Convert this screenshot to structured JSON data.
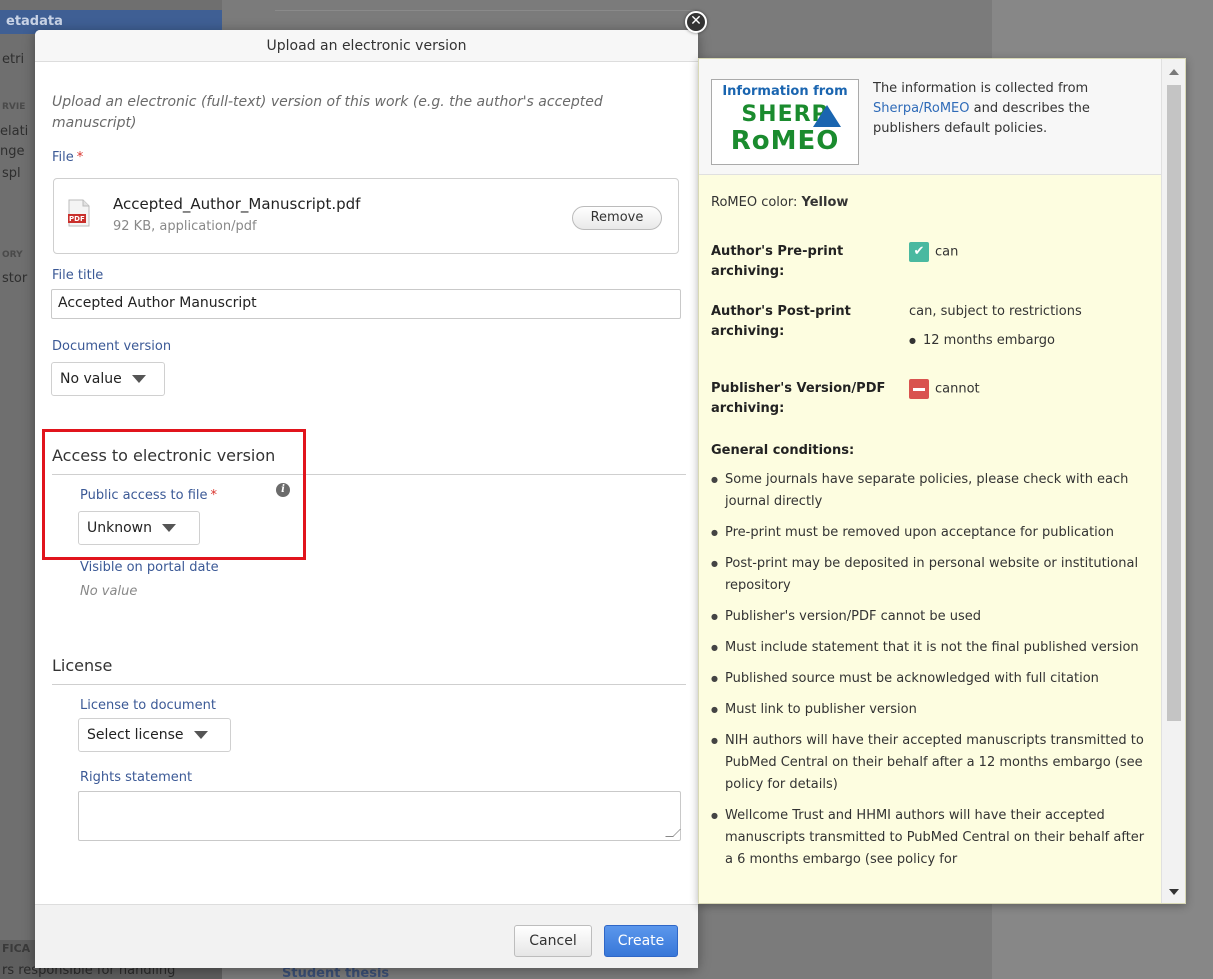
{
  "background": {
    "tab_label": "etadata",
    "side_items": [
      "etri",
      "RVIE",
      "elati",
      "nge",
      "spl",
      "ORY",
      "stor"
    ],
    "footer_caption": "FICA",
    "footer_text": "rs responsible for handling",
    "student_link": "Student thesis"
  },
  "dialog": {
    "title": "Upload an electronic version",
    "intro": "Upload an electronic (full-text) version of this work (e.g. the author's accepted manuscript)",
    "file_label": "File",
    "required_mark": "*",
    "file": {
      "name": "Accepted_Author_Manuscript.pdf",
      "meta": "92 KB, application/pdf",
      "icon_text": "PDF",
      "remove_label": "Remove"
    },
    "file_title_label": "File title",
    "file_title_value": "Accepted Author Manuscript",
    "document_version_label": "Document version",
    "document_version_value": "No value",
    "access_section_title": "Access to electronic version",
    "public_access_label": "Public access to file",
    "public_access_value": "Unknown",
    "visible_date_label": "Visible on portal date",
    "visible_date_value": "No value",
    "license_section_title": "License",
    "license_label": "License to document",
    "license_value": "Select license",
    "rights_label": "Rights statement",
    "cancel_label": "Cancel",
    "create_label": "Create",
    "highlight_color": "#e1141c"
  },
  "romeo": {
    "logo": {
      "line1": "Information from",
      "line2": "SHERP",
      "line3": "RoMEO"
    },
    "desc_pre": "The information is collected from ",
    "desc_link": "Sherpa/RoMEO",
    "desc_post": " and describes the publishers default policies.",
    "color_label": "RoMEO color: ",
    "color_value": "Yellow",
    "preprint_label": "Author's Pre-print archiving:",
    "preprint_value": "can",
    "postprint_label": "Author's Post-print archiving:",
    "postprint_value": "can, subject to restrictions",
    "postprint_sub": "12 months embargo",
    "publisher_label": "Publisher's Version/PDF archiving:",
    "publisher_value": "cannot",
    "conditions_title": "General conditions:",
    "conditions": [
      "Some journals have separate policies, please check with each journal directly",
      "Pre-print must be removed upon acceptance for publication",
      "Post-print may be deposited in personal website or institutional repository",
      "Publisher's version/PDF cannot be used",
      "Must include statement that it is not the final published version",
      "Published source must be acknowledged with full citation",
      "Must link to publisher version",
      "NIH authors will have their accepted manuscripts transmitted to PubMed Central on their behalf after a 12 months embargo (see policy for details)",
      "Wellcome Trust and HHMI authors will have their accepted manuscripts transmitted to PubMed Central on their behalf after a 6 months embargo (see policy for"
    ],
    "panel_color": "#fdfde0",
    "can_color": "#4ab9a0",
    "cannot_color": "#d9534f"
  }
}
